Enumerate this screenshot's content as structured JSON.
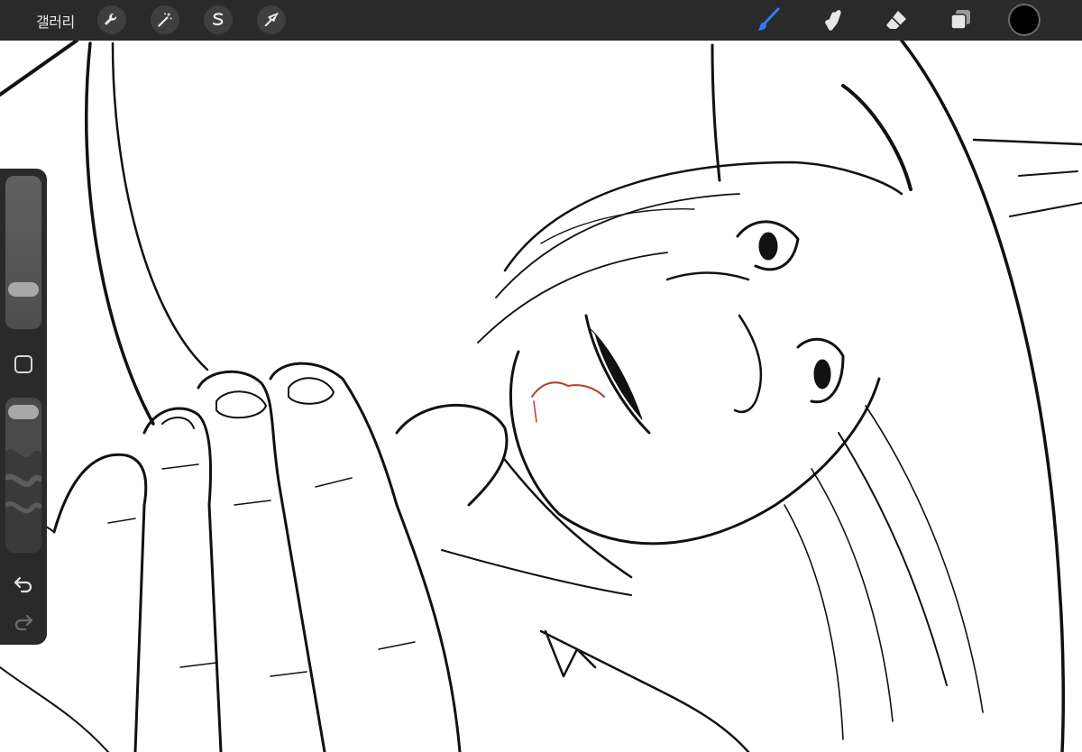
{
  "topbar": {
    "gallery_label": "갤러리",
    "left_tools": [
      {
        "name": "actions",
        "icon": "wrench-icon"
      },
      {
        "name": "adjustments",
        "icon": "magic-wand-icon"
      },
      {
        "name": "selection",
        "icon": "selection-s-icon"
      },
      {
        "name": "transform",
        "icon": "arrow-cursor-icon"
      }
    ],
    "right_tools": [
      {
        "name": "brush",
        "icon": "brush-icon",
        "active": true
      },
      {
        "name": "smudge",
        "icon": "smudge-finger-icon",
        "active": false
      },
      {
        "name": "eraser",
        "icon": "eraser-icon",
        "active": false
      },
      {
        "name": "layers",
        "icon": "layers-icon",
        "active": false
      }
    ],
    "current_color": "#000000",
    "active_color": "#2f7bf5"
  },
  "sidebar": {
    "brush_size": 0.22,
    "brush_opacity": 0.97,
    "modify_icon": "square-icon",
    "undo_icon": "undo-arrow-icon",
    "redo_icon": "redo-arrow-icon"
  },
  "canvas": {
    "content": "pencil-sketch",
    "stroke_color": "#111111",
    "accent_stroke_color": "#b5402c"
  }
}
